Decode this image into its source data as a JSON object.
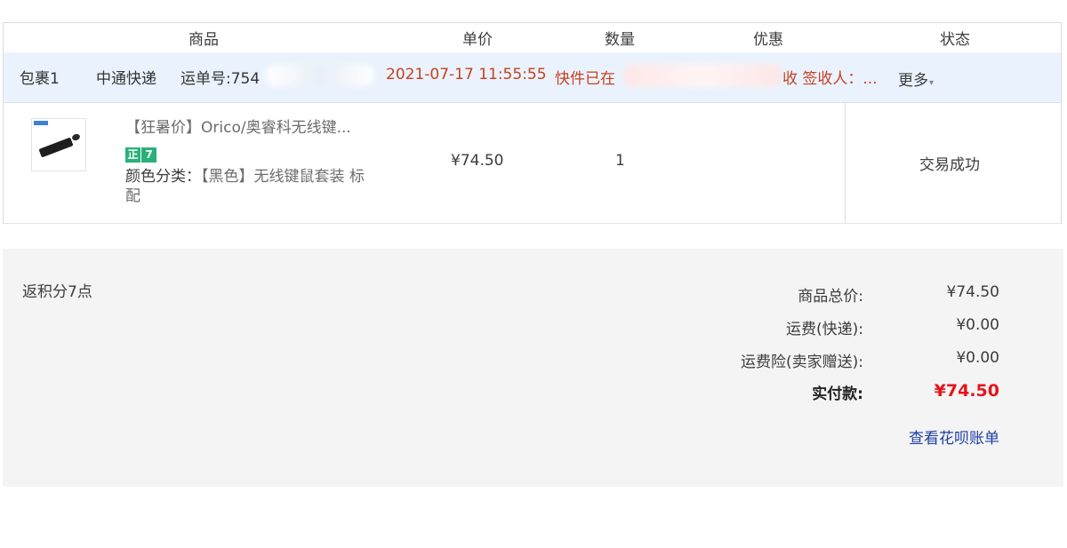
{
  "columns": {
    "product": "商品",
    "unit_price": "单价",
    "quantity": "数量",
    "discount": "优惠",
    "status": "状态"
  },
  "package": {
    "name": "包裹1",
    "carrier": "中通快递",
    "tracking_label": "运单号:754",
    "timestamp": "2021-07-17 11:55:55",
    "update_prefix": "快件已在",
    "update_suffix": "收 签收人：...",
    "more_label": "更多"
  },
  "item": {
    "title": "【狂暑价】Orico/奥睿科无线键...",
    "badges": [
      "正",
      "7"
    ],
    "sku_label": "颜色分类：",
    "sku_value": "【黑色】无线键鼠套装 标配",
    "price": "¥74.50",
    "quantity": "1",
    "status": "交易成功"
  },
  "summary": {
    "points": "返积分7点",
    "subtotal_label": "商品总价:",
    "subtotal_value": "¥74.50",
    "shipping_label": "运费(快递):",
    "shipping_value": "¥0.00",
    "insurance_label": "运费险(卖家赠送):",
    "insurance_value": "¥0.00",
    "total_label": "实付款:",
    "total_value": "¥74.50",
    "huabei_link": "查看花呗账单"
  },
  "colors": {
    "package_bar_bg": "#eaf3fd",
    "alert_text": "#c8401f",
    "total_red": "#e4141b",
    "link_blue": "#1f3fa0",
    "badge_green": "#2ab07a"
  },
  "icons": {
    "more_caret": "chevron-down-icon",
    "product_image": "keyboard-mouse-thumbnail"
  }
}
